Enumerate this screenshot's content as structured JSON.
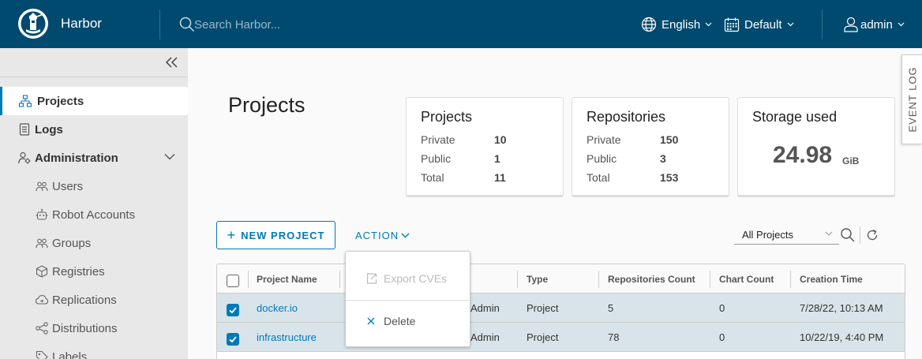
{
  "header": {
    "brand": "Harbor",
    "search_placeholder": "Search Harbor...",
    "language": "English",
    "date_format": "Default",
    "user": "admin"
  },
  "sidebar": {
    "items": [
      {
        "label": "Projects",
        "icon": "projects-icon",
        "active": true
      },
      {
        "label": "Logs",
        "icon": "logs-icon"
      },
      {
        "label": "Administration",
        "icon": "administration-icon",
        "expanded": true
      }
    ],
    "sub_items": [
      {
        "label": "Users",
        "icon": "users-icon"
      },
      {
        "label": "Robot Accounts",
        "icon": "robot-icon"
      },
      {
        "label": "Groups",
        "icon": "groups-icon"
      },
      {
        "label": "Registries",
        "icon": "registries-icon"
      },
      {
        "label": "Replications",
        "icon": "replications-icon"
      },
      {
        "label": "Distributions",
        "icon": "distributions-icon"
      },
      {
        "label": "Labels",
        "icon": "labels-icon"
      }
    ]
  },
  "main": {
    "title": "Projects",
    "event_log": "EVENT LOG",
    "cards": {
      "projects": {
        "title": "Projects",
        "private_label": "Private",
        "private": "10",
        "public_label": "Public",
        "public": "1",
        "total_label": "Total",
        "total": "11"
      },
      "repositories": {
        "title": "Repositories",
        "private_label": "Private",
        "private": "150",
        "public_label": "Public",
        "public": "3",
        "total_label": "Total",
        "total": "153"
      },
      "storage": {
        "title": "Storage used",
        "value": "24.98",
        "unit": "GiB"
      }
    },
    "toolbar": {
      "new_project": "NEW PROJECT",
      "action": "ACTION",
      "filter": "All Projects"
    },
    "action_menu": {
      "export_cves": "Export CVEs",
      "delete": "Delete"
    },
    "table": {
      "columns": [
        "Project Name",
        "Type",
        "Repositories Count",
        "Chart Count",
        "Creation Time"
      ],
      "rows": [
        {
          "name": "docker.io",
          "role": "Admin",
          "type": "Project",
          "repos": "5",
          "charts": "0",
          "created": "7/28/22, 10:13 AM",
          "selected": true
        },
        {
          "name": "infrastructure",
          "role": "Admin",
          "type": "Project",
          "repos": "78",
          "charts": "0",
          "created": "10/22/19, 4:40 PM",
          "selected": true
        }
      ]
    }
  },
  "colors": {
    "header_bg": "#004a70",
    "accent": "#0079b8",
    "sidebar_bg": "#e8e8e8",
    "selected_row_bg": "#d9e4ea"
  }
}
